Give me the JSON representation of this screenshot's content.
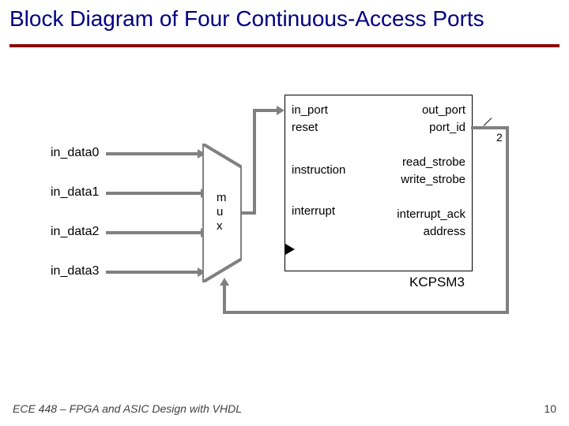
{
  "title": "Block Diagram of Four Continuous-Access Ports",
  "footer": "ECE 448 – FPGA and ASIC Design with VHDL",
  "page_number": "10",
  "inputs": {
    "in0": "in_data0",
    "in1": "in_data1",
    "in2": "in_data2",
    "in3": "in_data3"
  },
  "mux": {
    "letter0": "m",
    "letter1": "u",
    "letter2": "x"
  },
  "block": {
    "name": "KCPSM3",
    "left": {
      "in_port": "in_port",
      "reset": "reset",
      "instruction": "instruction",
      "interrupt": "interrupt"
    },
    "right": {
      "out_port": "out_port",
      "port_id": "port_id",
      "read_strobe": "read_strobe",
      "write_strobe": "write_strobe",
      "interrupt_ack": "interrupt_ack",
      "address": "address"
    }
  },
  "bus": {
    "port_id_width": "2"
  }
}
